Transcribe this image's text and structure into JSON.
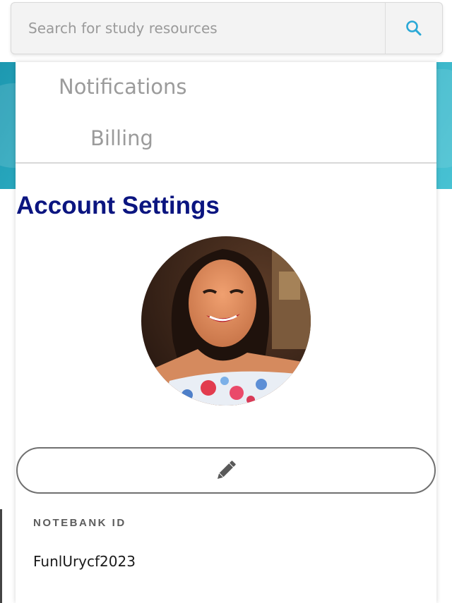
{
  "search": {
    "placeholder": "Search for study resources",
    "value": "",
    "button_icon": "search-icon"
  },
  "menu": {
    "items": [
      {
        "label": "Notifications"
      },
      {
        "label": "Billing"
      }
    ]
  },
  "page": {
    "title": "Account Settings"
  },
  "profile": {
    "avatar_icon": "avatar",
    "edit_icon": "pencil-icon"
  },
  "fields": {
    "notebank_id": {
      "label": "NOTEBANK ID",
      "value": "FunlUrycf2023"
    }
  },
  "colors": {
    "title": "#0b1580",
    "accent_teal": "#2aa9bf",
    "search_icon": "#29a8d6",
    "menu_text": "#9b9b9b"
  }
}
